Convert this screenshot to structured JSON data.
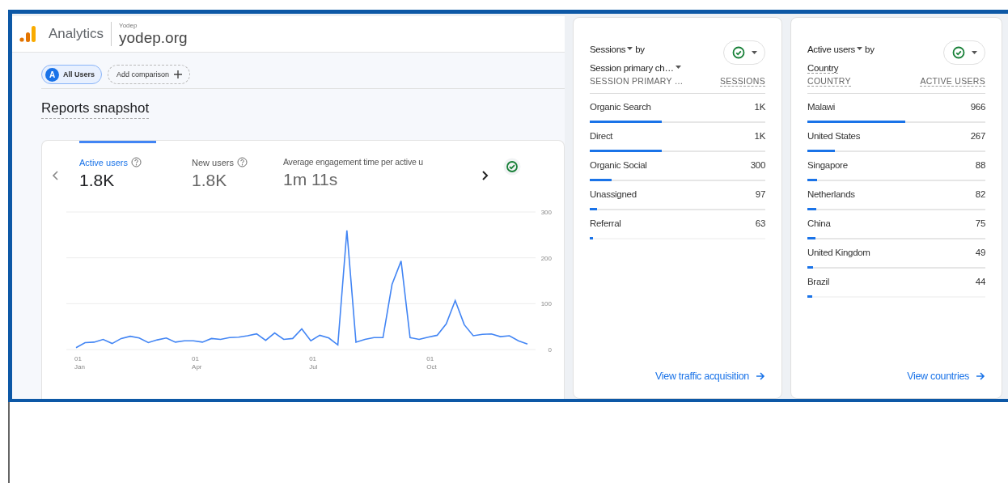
{
  "app": {
    "product": "Analytics",
    "account": "Yodep",
    "property": "yodep.org"
  },
  "comparisons": [
    {
      "kind": "segment",
      "badge": "A",
      "label": "All Users"
    },
    {
      "kind": "add",
      "label": "Add comparison"
    }
  ],
  "title": "Reports snapshot",
  "overview": {
    "metrics": [
      {
        "label": "Active users",
        "value": "1.8K",
        "selected": true,
        "help": true
      },
      {
        "label": "New users",
        "value": "1.8K",
        "selected": false,
        "help": true
      },
      {
        "label": "Average engagement time per active u",
        "value": "1m 11s",
        "selected": false,
        "help": false
      }
    ],
    "chart_data": {
      "type": "line",
      "categories": [
        "01\nJan",
        null,
        null,
        null,
        null,
        null,
        null,
        null,
        null,
        null,
        null,
        null,
        null,
        "01\nApr",
        null,
        null,
        null,
        null,
        null,
        null,
        null,
        null,
        null,
        null,
        null,
        null,
        "01\nJul",
        null,
        null,
        null,
        null,
        null,
        null,
        null,
        null,
        null,
        null,
        null,
        null,
        "01\nOct",
        null,
        null,
        null,
        null,
        null,
        null,
        null,
        null,
        null,
        null,
        null
      ],
      "series": [
        {
          "color": "#4285f4",
          "values": [
            4,
            15,
            16,
            22,
            13,
            24,
            29,
            25,
            15,
            21,
            25,
            16,
            19,
            19,
            16,
            24,
            22,
            26,
            27,
            30,
            34,
            20,
            36,
            22,
            24,
            45,
            19,
            31,
            25,
            10,
            260,
            16,
            22,
            26,
            26,
            142,
            193,
            26,
            22,
            27,
            31,
            56,
            107,
            54,
            30,
            33,
            34,
            28,
            30,
            19,
            12
          ]
        }
      ],
      "ylim": [
        0,
        300
      ],
      "yticks": [
        0,
        100,
        200,
        300
      ]
    }
  },
  "cards": [
    {
      "metric": "Sessions",
      "by": "by",
      "dimension": "Session primary ch…",
      "dimension_dropdown": true,
      "columns": [
        "SESSION PRIMARY …",
        "SESSIONS"
      ],
      "rows": [
        {
          "name": "Organic Search",
          "value": "1K",
          "level": 0.41
        },
        {
          "name": "Direct",
          "value": "1K",
          "level": 0.41
        },
        {
          "name": "Organic Social",
          "value": "300",
          "level": 0.125
        },
        {
          "name": "Unassigned",
          "value": "97",
          "level": 0.04
        },
        {
          "name": "Referral",
          "value": "63",
          "level": 0.02
        }
      ],
      "link": "View traffic acquisition"
    },
    {
      "metric": "Active users",
      "by": "by",
      "dimension": "Country",
      "dimension_dropdown": false,
      "columns": [
        "COUNTRY",
        "ACTIVE USERS"
      ],
      "rows": [
        {
          "name": "Malawi",
          "value": "966",
          "level": 0.55
        },
        {
          "name": "United States",
          "value": "267",
          "level": 0.155
        },
        {
          "name": "Singapore",
          "value": "88",
          "level": 0.055
        },
        {
          "name": "Netherlands",
          "value": "82",
          "level": 0.05
        },
        {
          "name": "China",
          "value": "75",
          "level": 0.045
        },
        {
          "name": "United Kingdom",
          "value": "49",
          "level": 0.03
        },
        {
          "name": "Brazil",
          "value": "44",
          "level": 0.025
        }
      ],
      "link": "View countries"
    }
  ]
}
